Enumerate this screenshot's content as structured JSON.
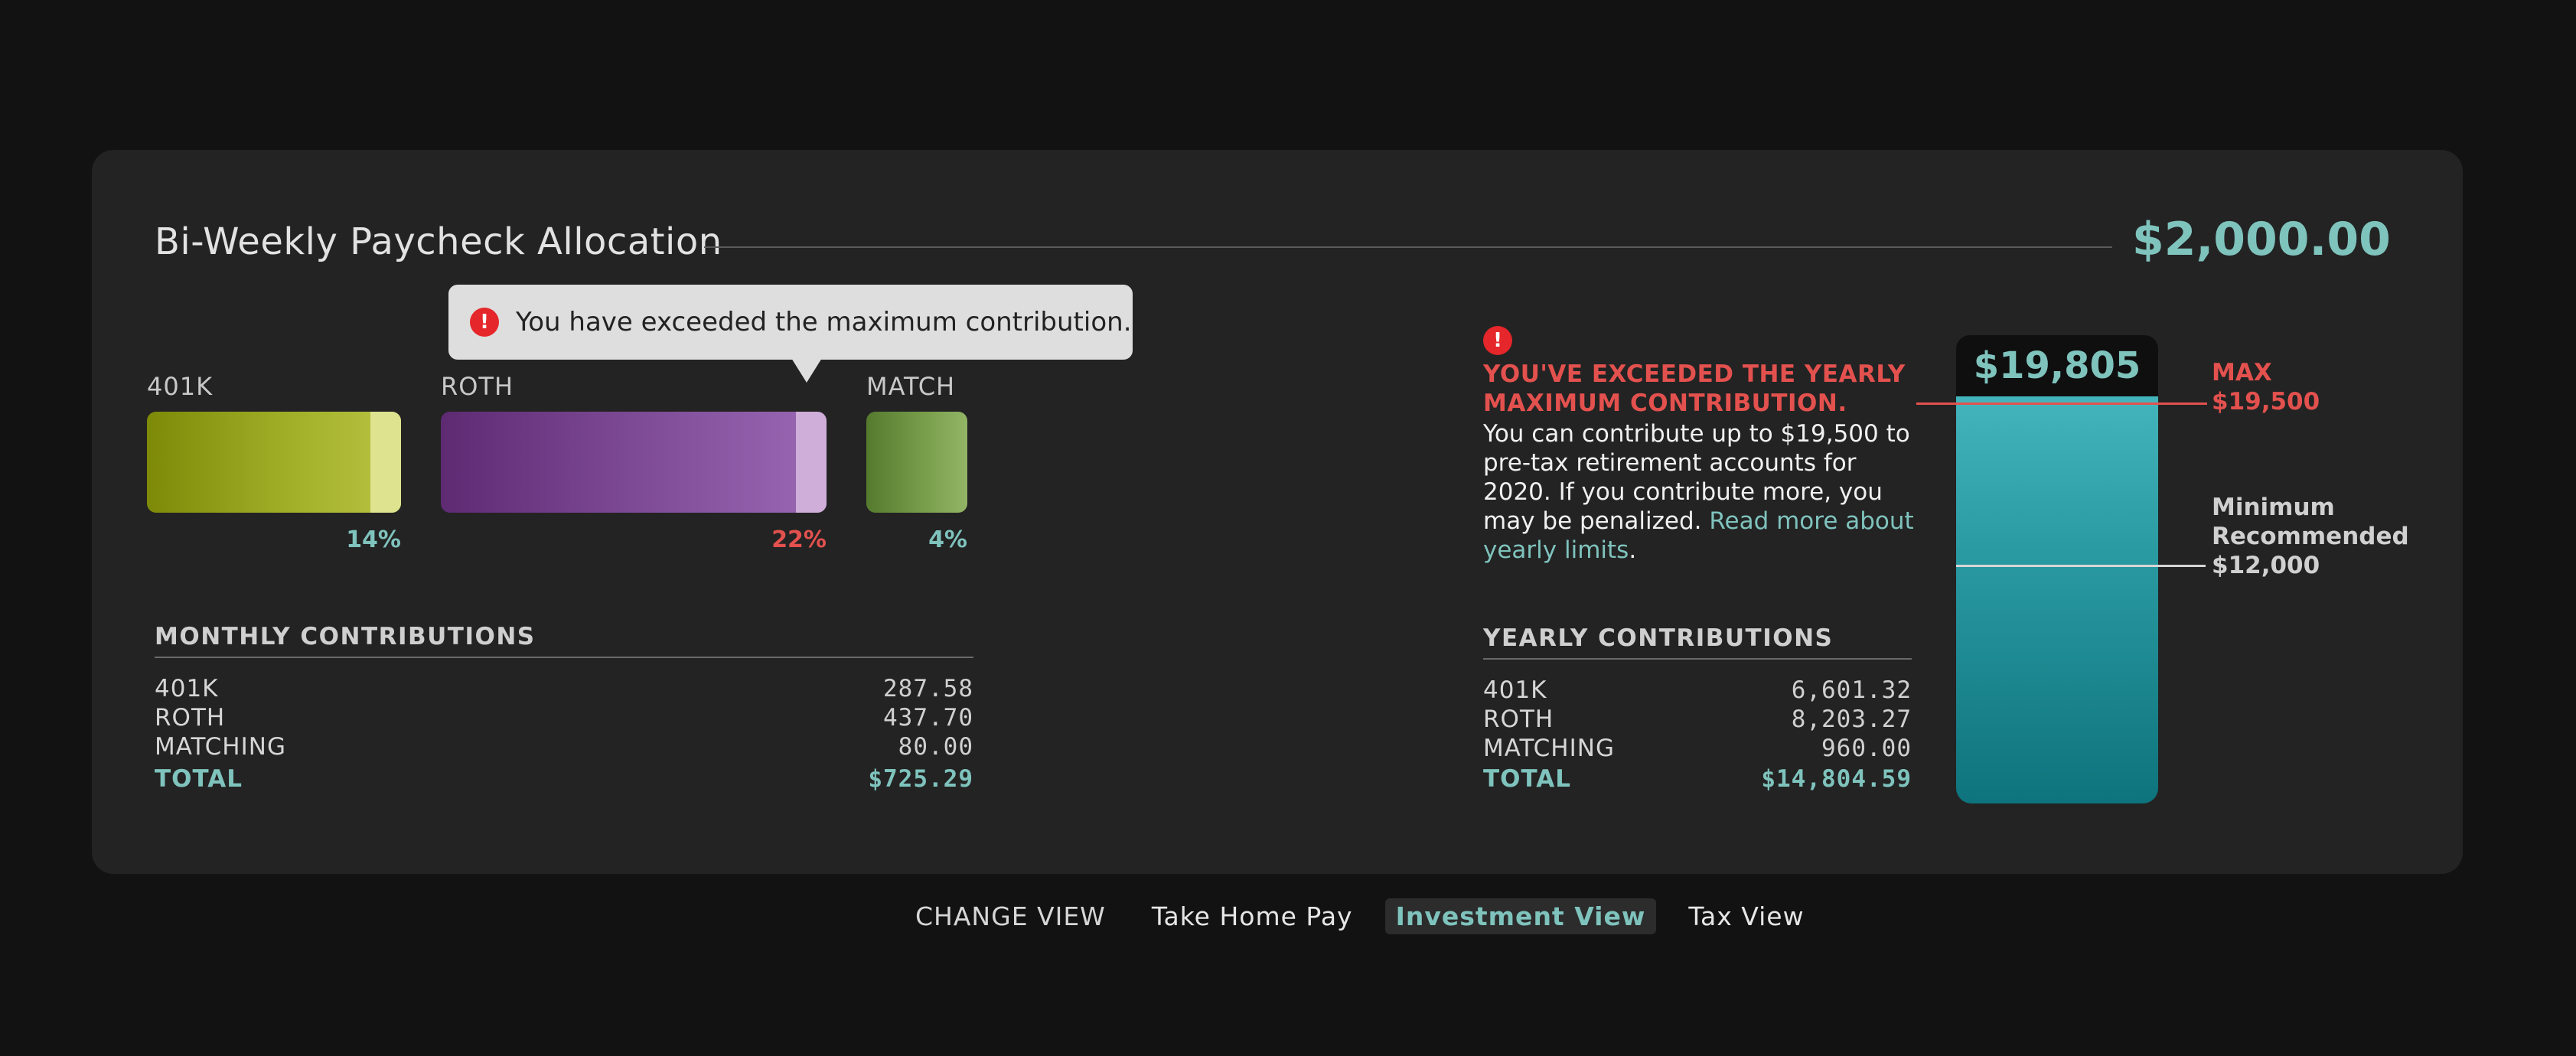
{
  "header": {
    "title": "Bi-Weekly Paycheck Allocation",
    "amount": "$2,000.00"
  },
  "tooltip": {
    "message": "You have exceeded the maximum contribution.",
    "icon": "alert-icon"
  },
  "bars": [
    {
      "label": "401K",
      "percent": "14%",
      "percent_color": "#7fc3bd"
    },
    {
      "label": "ROTH",
      "percent": "22%",
      "percent_color": "#e3514e"
    },
    {
      "label": "MATCH",
      "percent": "4%",
      "percent_color": "#7fc3bd"
    }
  ],
  "monthly": {
    "heading": "MONTHLY CONTRIBUTIONS",
    "rows": [
      {
        "label": "401K",
        "value": "287.58"
      },
      {
        "label": "ROTH",
        "value": "437.70"
      },
      {
        "label": "MATCHING",
        "value": "80.00"
      }
    ],
    "total_label": "TOTAL",
    "total_value": "$725.29"
  },
  "warning": {
    "heading": "YOU'VE EXCEEDED THE YEARLY MAXIMUM CONTRIBUTION.",
    "body": "You can contribute up to $19,500 to pre-tax retirement accounts for 2020. If you contribute more, you may be penalized. ",
    "link": "Read more about yearly limits",
    "trailing": "."
  },
  "yearly": {
    "heading": "YEARLY CONTRIBUTIONS",
    "rows": [
      {
        "label": "401K",
        "value": "6,601.32"
      },
      {
        "label": "ROTH",
        "value": "8,203.27"
      },
      {
        "label": "MATCHING",
        "value": "960.00"
      }
    ],
    "total_label": "TOTAL",
    "total_value": "$14,804.59"
  },
  "tank": {
    "value": "$19,805",
    "max_label": "MAX",
    "max_value": "$19,500",
    "min_label_1": "Minimum",
    "min_label_2": "Recommended",
    "min_value": "$12,000"
  },
  "nav": {
    "lead": "CHANGE VIEW",
    "items": [
      "Take Home Pay",
      "Investment View",
      "Tax View"
    ],
    "active": "Investment View"
  },
  "colors": {
    "accent": "#7fc3bd",
    "error": "#e3514e",
    "olive": "#a3b12a",
    "purple": "#8a4fa0",
    "green": "#7a9f4c"
  }
}
